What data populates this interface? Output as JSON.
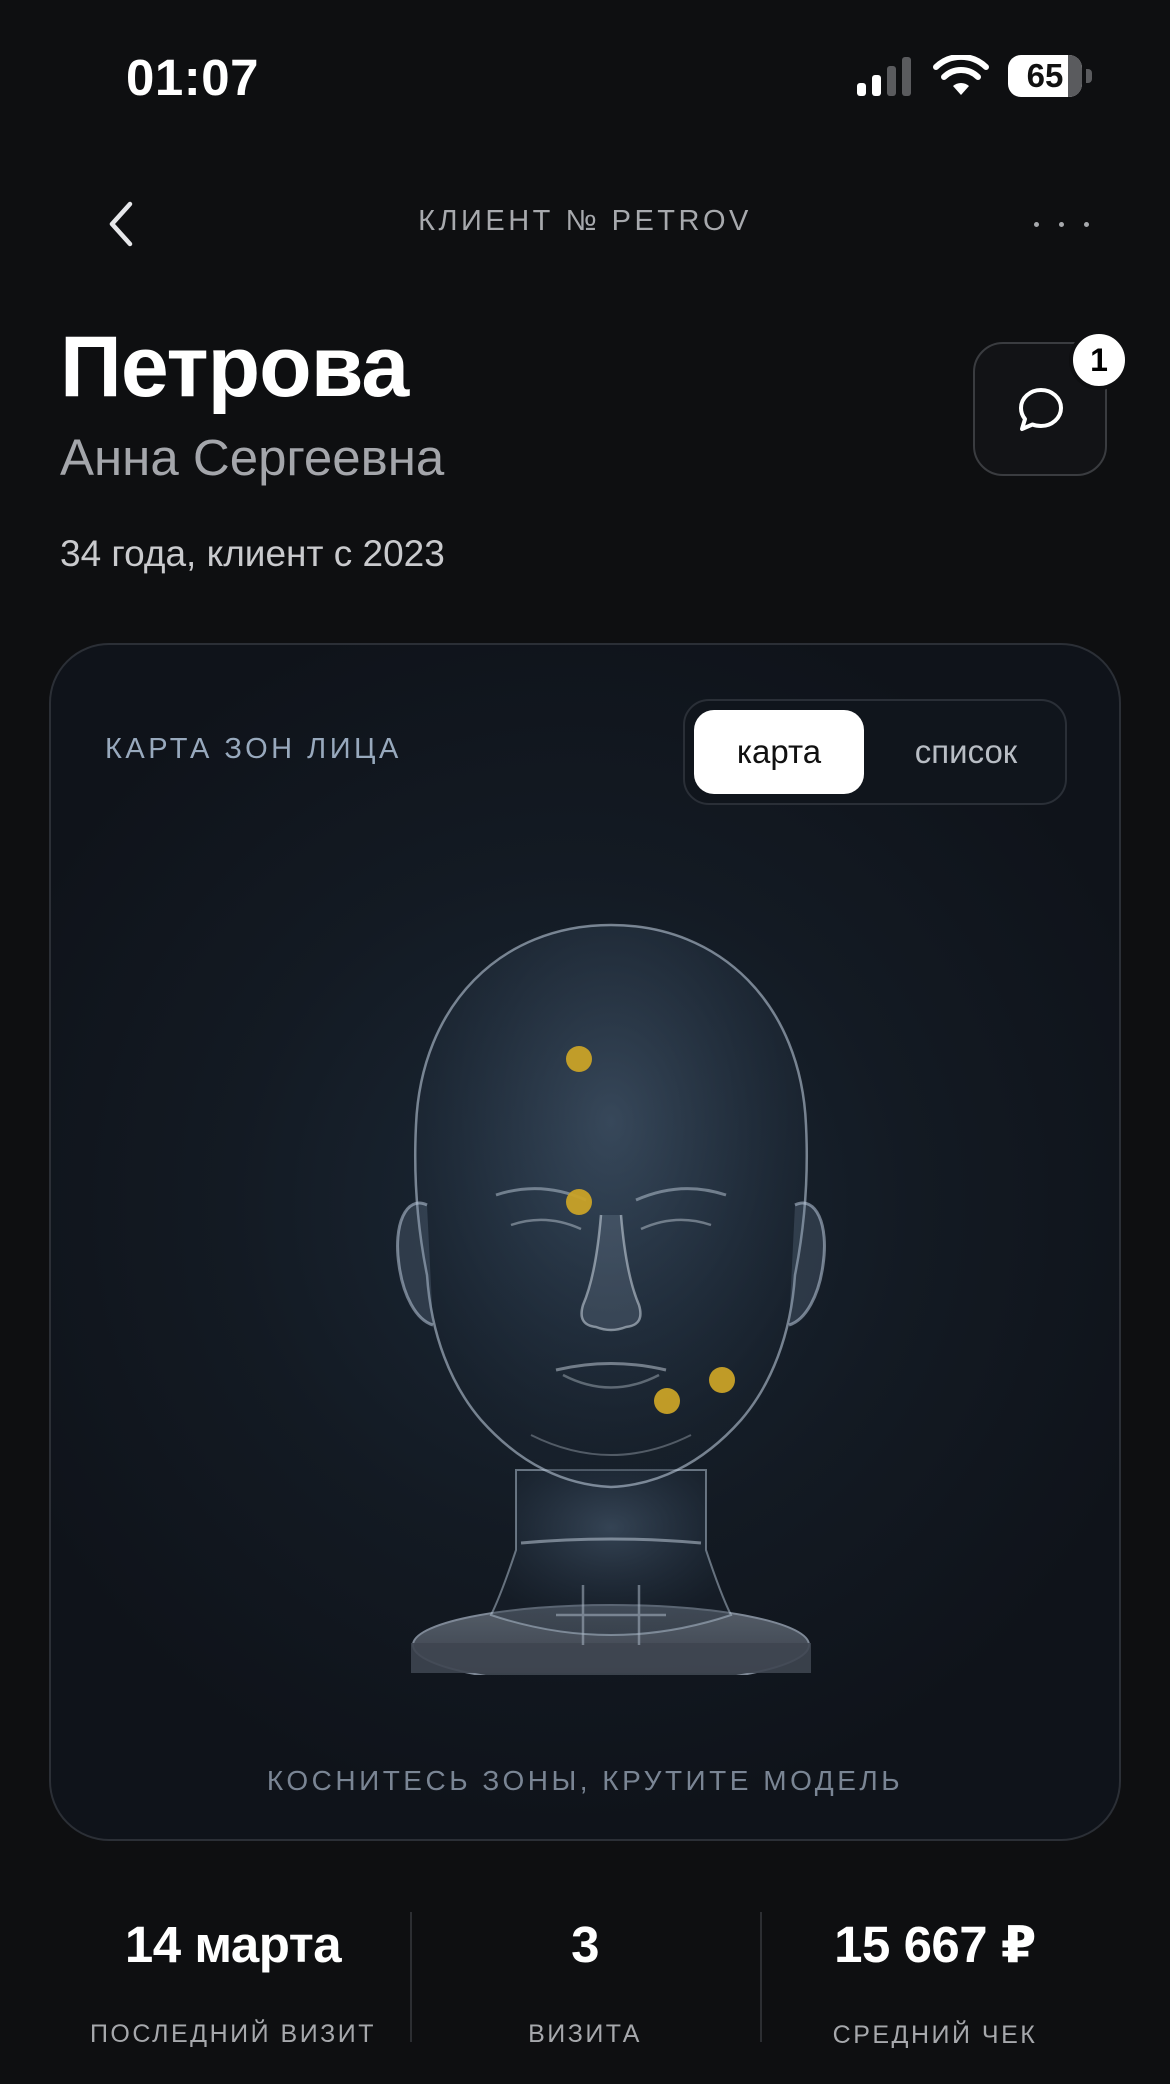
{
  "status_bar": {
    "time": "01:07",
    "battery": "65"
  },
  "header": {
    "title": "КЛИЕНТ № PETROV"
  },
  "client": {
    "last_name": "Петрова",
    "first_name": "Анна Сергеевна",
    "details": "34 года, клиент с 2023"
  },
  "chat": {
    "badge": "1"
  },
  "face_map": {
    "title": "КАРТА ЗОН ЛИЦА",
    "toggle_active": "карта",
    "toggle_inactive": "список",
    "hint": "КОСНИТЕСЬ ЗОНЫ, КРУТИТЕ МОДЕЛЬ",
    "zone_color": "#c9a227",
    "zones_count_shown": 4
  },
  "stats": [
    {
      "value": "14 марта",
      "label": "ПОСЛЕДНИЙ ВИЗИТ"
    },
    {
      "value": "3",
      "label": "ВИЗИТА"
    },
    {
      "value": "15 667 ₽",
      "label": "СРЕДНИЙ ЧЕК"
    }
  ],
  "icons": {
    "back": "chevron-left-icon",
    "more": "more-dots-icon",
    "chat": "chat-bubble-icon",
    "signal": "cellular-signal-icon",
    "wifi": "wifi-icon",
    "battery": "battery-icon"
  }
}
